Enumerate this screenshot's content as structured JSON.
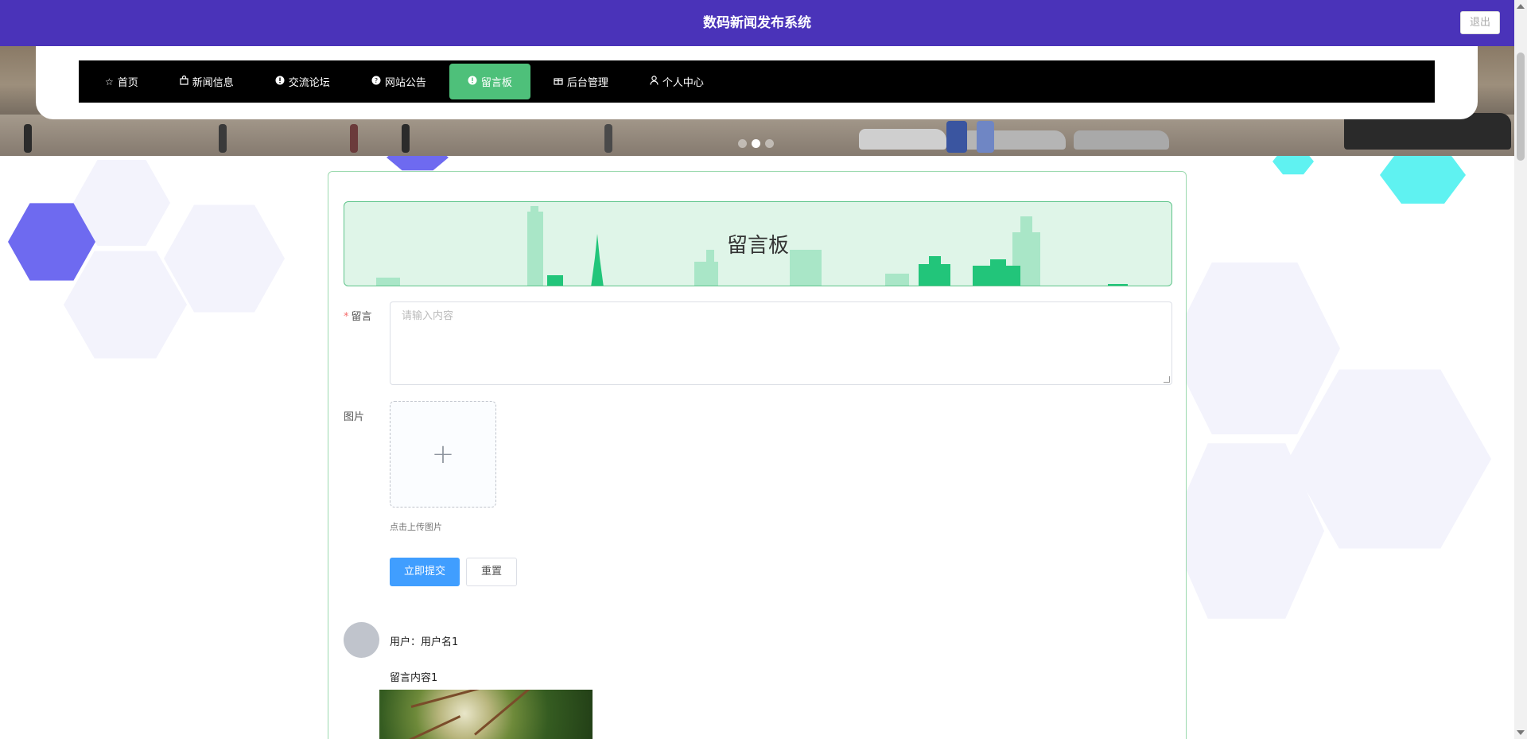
{
  "header": {
    "title": "数码新闻发布系统",
    "logout_label": "退出"
  },
  "nav": {
    "items": [
      {
        "icon": "star-icon",
        "label": "首页"
      },
      {
        "icon": "bag-icon",
        "label": "新闻信息"
      },
      {
        "icon": "info-icon",
        "label": "交流论坛"
      },
      {
        "icon": "question-icon",
        "label": "网站公告"
      },
      {
        "icon": "info-icon",
        "label": "留言板",
        "active": true
      },
      {
        "icon": "gift-icon",
        "label": "后台管理"
      },
      {
        "icon": "user-icon",
        "label": "个人中心"
      }
    ]
  },
  "carousel": {
    "slide_count": 3,
    "active_index": 1
  },
  "board": {
    "title": "留言板"
  },
  "form": {
    "message_label": "留言",
    "message_placeholder": "请输入内容",
    "image_label": "图片",
    "upload_hint": "点击上传图片",
    "submit_label": "立即提交",
    "reset_label": "重置"
  },
  "messages": [
    {
      "user_text": "用户：用户名1",
      "content": "留言内容1"
    }
  ],
  "colors": {
    "topbar": "#4a33b9",
    "nav_active": "#4ec07a",
    "primary_button": "#409eff",
    "panel_border": "#9bd9ae"
  }
}
